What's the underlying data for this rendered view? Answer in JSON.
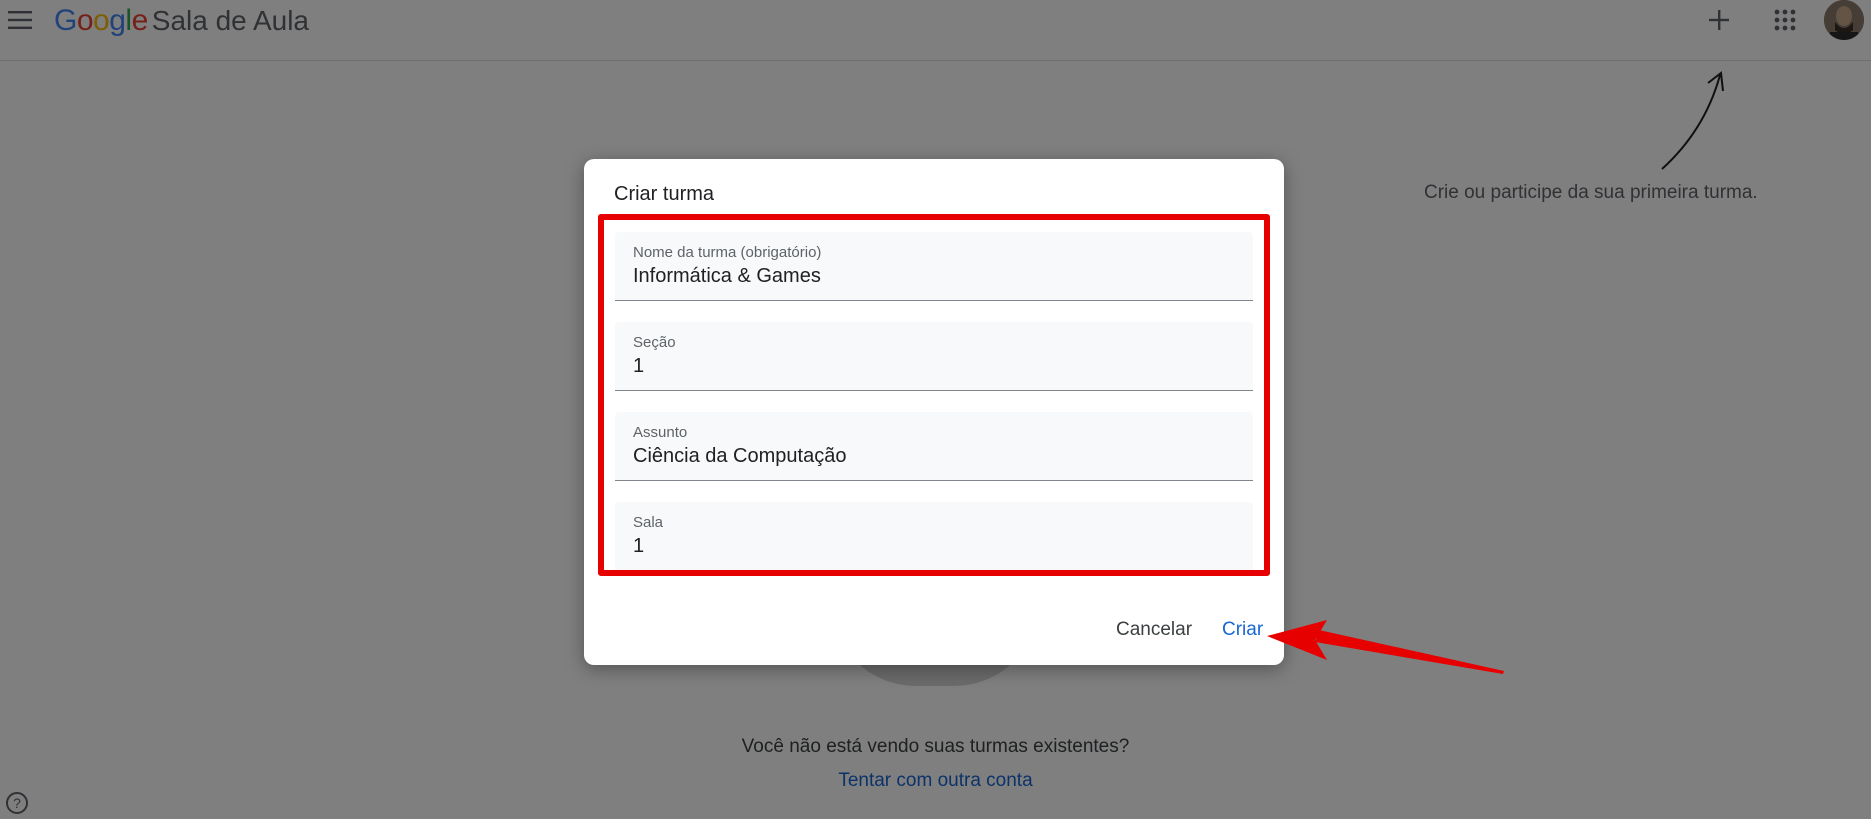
{
  "header": {
    "logo_letters": [
      {
        "char": "G",
        "color": "#4285F4"
      },
      {
        "char": "o",
        "color": "#EA4335"
      },
      {
        "char": "o",
        "color": "#FBBC05"
      },
      {
        "char": "g",
        "color": "#4285F4"
      },
      {
        "char": "l",
        "color": "#34A853"
      },
      {
        "char": "e",
        "color": "#EA4335"
      }
    ],
    "product_name": "Sala de Aula",
    "icons": [
      "menu-icon",
      "plus-icon",
      "apps-grid-icon",
      "avatar"
    ]
  },
  "background": {
    "hint": "Crie ou participe da sua primeira turma.",
    "no_classes_question": "Você não está vendo suas turmas existentes?",
    "other_account_link": "Tentar com outra conta",
    "help_icon": "help-circle-icon"
  },
  "dialog": {
    "title": "Criar turma",
    "fields": [
      {
        "label": "Nome da turma (obrigatório)",
        "value": "Informática & Games"
      },
      {
        "label": "Seção",
        "value": "1"
      },
      {
        "label": "Assunto",
        "value": "Ciência da Computação"
      },
      {
        "label": "Sala",
        "value": "1"
      }
    ],
    "cancel_label": "Cancelar",
    "create_label": "Criar"
  },
  "colors": {
    "accent_blue": "#1967d2",
    "annotation_red": "#e60000"
  }
}
